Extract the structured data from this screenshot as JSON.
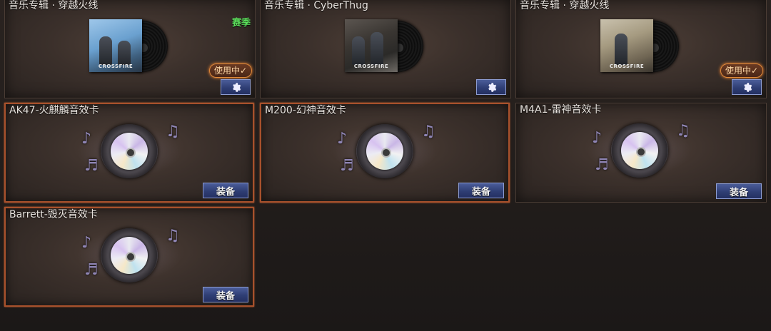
{
  "albums": [
    {
      "title": "音乐专辑 · 穿越火线",
      "badge": "赛季",
      "status": "使用中✓",
      "cover": "c1"
    },
    {
      "title": "音乐专辑 · CyberThug",
      "badge": "",
      "status": "",
      "cover": "c2"
    },
    {
      "title": "音乐专辑 · 穿越火线",
      "badge": "",
      "status": "使用中✓",
      "cover": "c3"
    }
  ],
  "sound_cards": [
    {
      "title": "AK47-火麒麟音效卡",
      "button": "装备"
    },
    {
      "title": "M200-幻神音效卡",
      "button": "装备"
    },
    {
      "title": "M4A1-雷神音效卡",
      "button": "装备"
    },
    {
      "title": "Barrett-毁灭音效卡",
      "button": "装备"
    }
  ],
  "icons": {
    "settings": "gear-icon",
    "note": "music-note-icon",
    "disc": "cd-icon",
    "record": "vinyl-icon"
  },
  "colors": {
    "accent_button": "#2f3e74",
    "season_green": "#5ce05c",
    "in_use_orange": "#e08a3a",
    "selected_border": "#a8512c"
  }
}
